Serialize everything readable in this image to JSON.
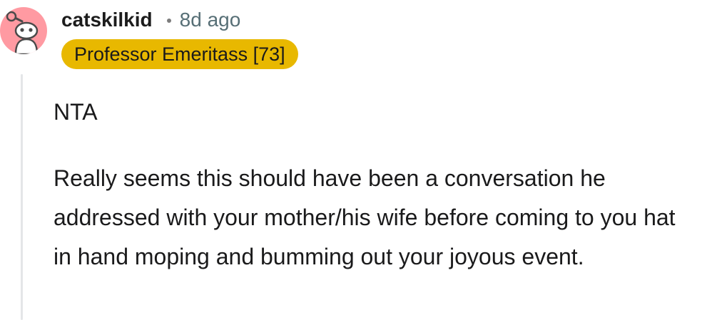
{
  "comment": {
    "author": "catskilkid",
    "timestamp": "8d ago",
    "flair": "Professor Emeritass [73]",
    "avatar_icon": "reddit-snoo-avatar-icon",
    "colors": {
      "avatar_bg": "#ff9aa2",
      "flair_bg": "#e8b800",
      "meta_text": "#576f76",
      "thread_line": "#e4e6e8"
    },
    "paragraphs": [
      "NTA",
      "Really seems this should have been a conversation he addressed with your mother/his wife before coming to you hat in hand moping and bumming out your joyous event."
    ]
  }
}
